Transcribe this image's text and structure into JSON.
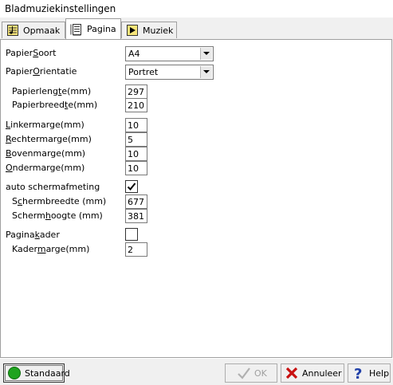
{
  "window": {
    "title": "Bladmuziekinstellingen"
  },
  "tabs": [
    {
      "label": "Opmaak",
      "icon": "music-sheet-icon"
    },
    {
      "label": "Pagina",
      "icon": "page-icon",
      "active": true
    },
    {
      "label": "Muziek",
      "icon": "play-icon"
    }
  ],
  "paper": {
    "type": {
      "label_pre": "Papier",
      "label_ul": "S",
      "label_post": "oort",
      "value": "A4"
    },
    "orientation": {
      "label_pre": "Papier",
      "label_ul": "O",
      "label_post": "rientatie",
      "value": "Portret"
    },
    "length": {
      "label_pre": "Papierleng",
      "label_ul": "t",
      "label_post": "e(mm)",
      "value": "297"
    },
    "width": {
      "label_pre": "Papierbreed",
      "label_ul": "t",
      "label_post": "e(mm)",
      "value": "210"
    }
  },
  "margins": {
    "left": {
      "label_pre": "",
      "label_ul": "L",
      "label_post": "inkermarge(mm)",
      "value": "10"
    },
    "right": {
      "label_pre": "",
      "label_ul": "R",
      "label_post": "echtermarge(mm)",
      "value": "5"
    },
    "top": {
      "label_pre": "",
      "label_ul": "B",
      "label_post": "ovenmarge(mm)",
      "value": "10"
    },
    "bottom": {
      "label_pre": "",
      "label_ul": "O",
      "label_post": "ndermarge(mm)",
      "value": "10"
    }
  },
  "screen": {
    "auto": {
      "label": "auto schermafmeting",
      "checked": true
    },
    "width": {
      "label_pre": "S",
      "label_ul": "c",
      "label_post": "hermbreedte (mm)",
      "value": "677"
    },
    "height": {
      "label_pre": "Scherm",
      "label_ul": "h",
      "label_post": "oogte (mm)",
      "value": "381"
    }
  },
  "frame": {
    "page_frame": {
      "label_pre": "Pagina",
      "label_ul": "k",
      "label_post": "ader",
      "checked": false
    },
    "frame_margin": {
      "label_pre": "Kader",
      "label_ul": "m",
      "label_post": "arge(mm)",
      "value": "2"
    }
  },
  "buttons": {
    "default": {
      "label": "Standaard",
      "icon": "green-circle-icon"
    },
    "ok": {
      "label": "OK",
      "icon": "check-icon",
      "enabled": false
    },
    "cancel": {
      "label": "Annuleer",
      "icon": "close-icon"
    },
    "help": {
      "label": "Help",
      "icon": "question-icon"
    }
  },
  "colors": {
    "accent_green": "#1fa31f",
    "cancel_red": "#c81010",
    "help_blue": "#1f3fa8"
  }
}
